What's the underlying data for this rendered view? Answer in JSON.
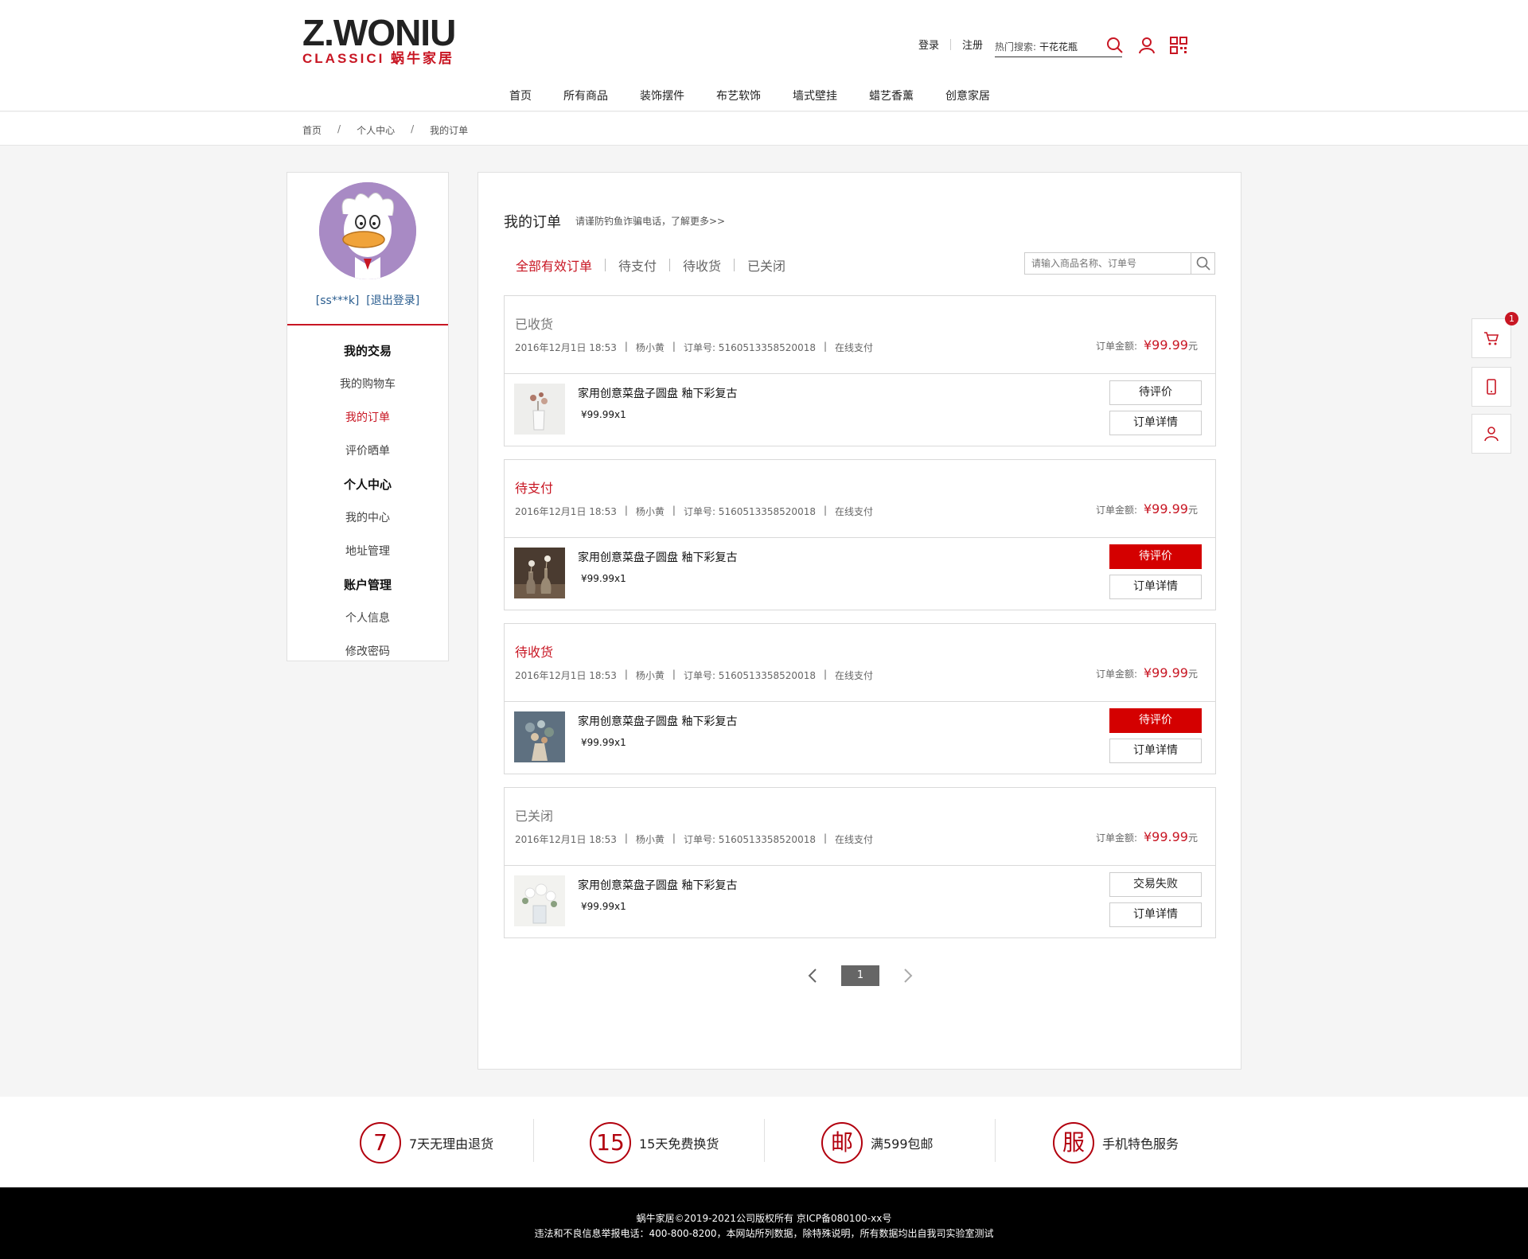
{
  "header": {
    "logo_main": "Z.WONIU",
    "logo_sub": "CLASSICI 蜗牛家居",
    "login_label": "登录",
    "register_label": "注册",
    "hot_search_label": "热门搜索:",
    "hot_search_keyword": "干花花瓶"
  },
  "nav": {
    "items": [
      "首页",
      "所有商品",
      "装饰摆件",
      "布艺软饰",
      "墙式壁挂",
      "蜡艺香薰",
      "创意家居"
    ]
  },
  "breadcrumb": {
    "items": [
      "首页",
      "个人中心",
      "我的订单"
    ],
    "separator": "/"
  },
  "sidebar": {
    "user_text": "[ss***k]",
    "logout_text": "[退出登录]",
    "groups": [
      {
        "title": "我的交易",
        "items": [
          "我的购物车",
          "我的订单",
          "评价晒单"
        ]
      },
      {
        "title": "个人中心",
        "items": [
          "我的中心",
          "地址管理"
        ]
      },
      {
        "title": "账户管理",
        "items": [
          "个人信息",
          "修改密码"
        ]
      }
    ],
    "active_item": "我的订单"
  },
  "main": {
    "title": "我的订单",
    "tip": "请谨防钓鱼诈骗电话，了解更多>>",
    "tabs": [
      "全部有效订单",
      "待支付",
      "待收货",
      "已关闭"
    ],
    "active_tab": "全部有效订单",
    "search_placeholder": "请输入商品名称、订单号",
    "amount_label": "订单金额:",
    "unit": "元",
    "orders": [
      {
        "status": "已收货",
        "status_color": "#777777",
        "date": "2016年12月1日 18:53",
        "name": "杨小黄",
        "order_no": "订单号: 5160513358520018",
        "pay": "在线支付",
        "price": "¥99.99",
        "product": "家用创意菜盘子圆盘 釉下彩复古",
        "qty": "¥99.99x1",
        "btn1": "待评价",
        "btn1_red": false,
        "btn2": "订单详情",
        "thumb": "white-vase-icon"
      },
      {
        "status": "待支付",
        "status_color": "#c81623",
        "date": "2016年12月1日 18:53",
        "name": "杨小黄",
        "order_no": "订单号: 5160513358520018",
        "pay": "在线支付",
        "price": "¥99.99",
        "product": "家用创意菜盘子圆盘 釉下彩复古",
        "qty": "¥99.99x1",
        "btn1": "待评价",
        "btn1_red": true,
        "btn2": "订单详情",
        "thumb": "bottle-vase-icon"
      },
      {
        "status": "待收货",
        "status_color": "#c81623",
        "date": "2016年12月1日 18:53",
        "name": "杨小黄",
        "order_no": "订单号: 5160513358520018",
        "pay": "在线支付",
        "price": "¥99.99",
        "product": "家用创意菜盘子圆盘 釉下彩复古",
        "qty": "¥99.99x1",
        "btn1": "待评价",
        "btn1_red": true,
        "btn2": "订单详情",
        "thumb": "bouquet-icon"
      },
      {
        "status": "已关闭",
        "status_color": "#777777",
        "date": "2016年12月1日 18:53",
        "name": "杨小黄",
        "order_no": "订单号: 5160513358520018",
        "pay": "在线支付",
        "price": "¥99.99",
        "product": "家用创意菜盘子圆盘 釉下彩复古",
        "qty": "¥99.99x1",
        "btn1": "交易失败",
        "btn1_red": false,
        "btn2": "订单详情",
        "thumb": "white-flowers-icon"
      }
    ],
    "pager": {
      "current": "1"
    }
  },
  "float_bar": {
    "cart_count": "1"
  },
  "services": [
    {
      "icon_text": "7",
      "label": "7天无理由退货"
    },
    {
      "icon_text": "15",
      "label": "15天免费换货"
    },
    {
      "icon_text": "邮",
      "label": "满599包邮"
    },
    {
      "icon_text": "服",
      "label": "手机特色服务"
    }
  ],
  "footer": {
    "line1": "蜗牛家居©2019-2021公司版权所有 京ICP备080100-xx号",
    "line2": "违法和不良信息举报电话：400-800-8200，本网站所列数据，除特殊说明，所有数据均出自我司实验室测试"
  },
  "colors": {
    "accent": "#c81623",
    "button_red": "#d40000"
  }
}
